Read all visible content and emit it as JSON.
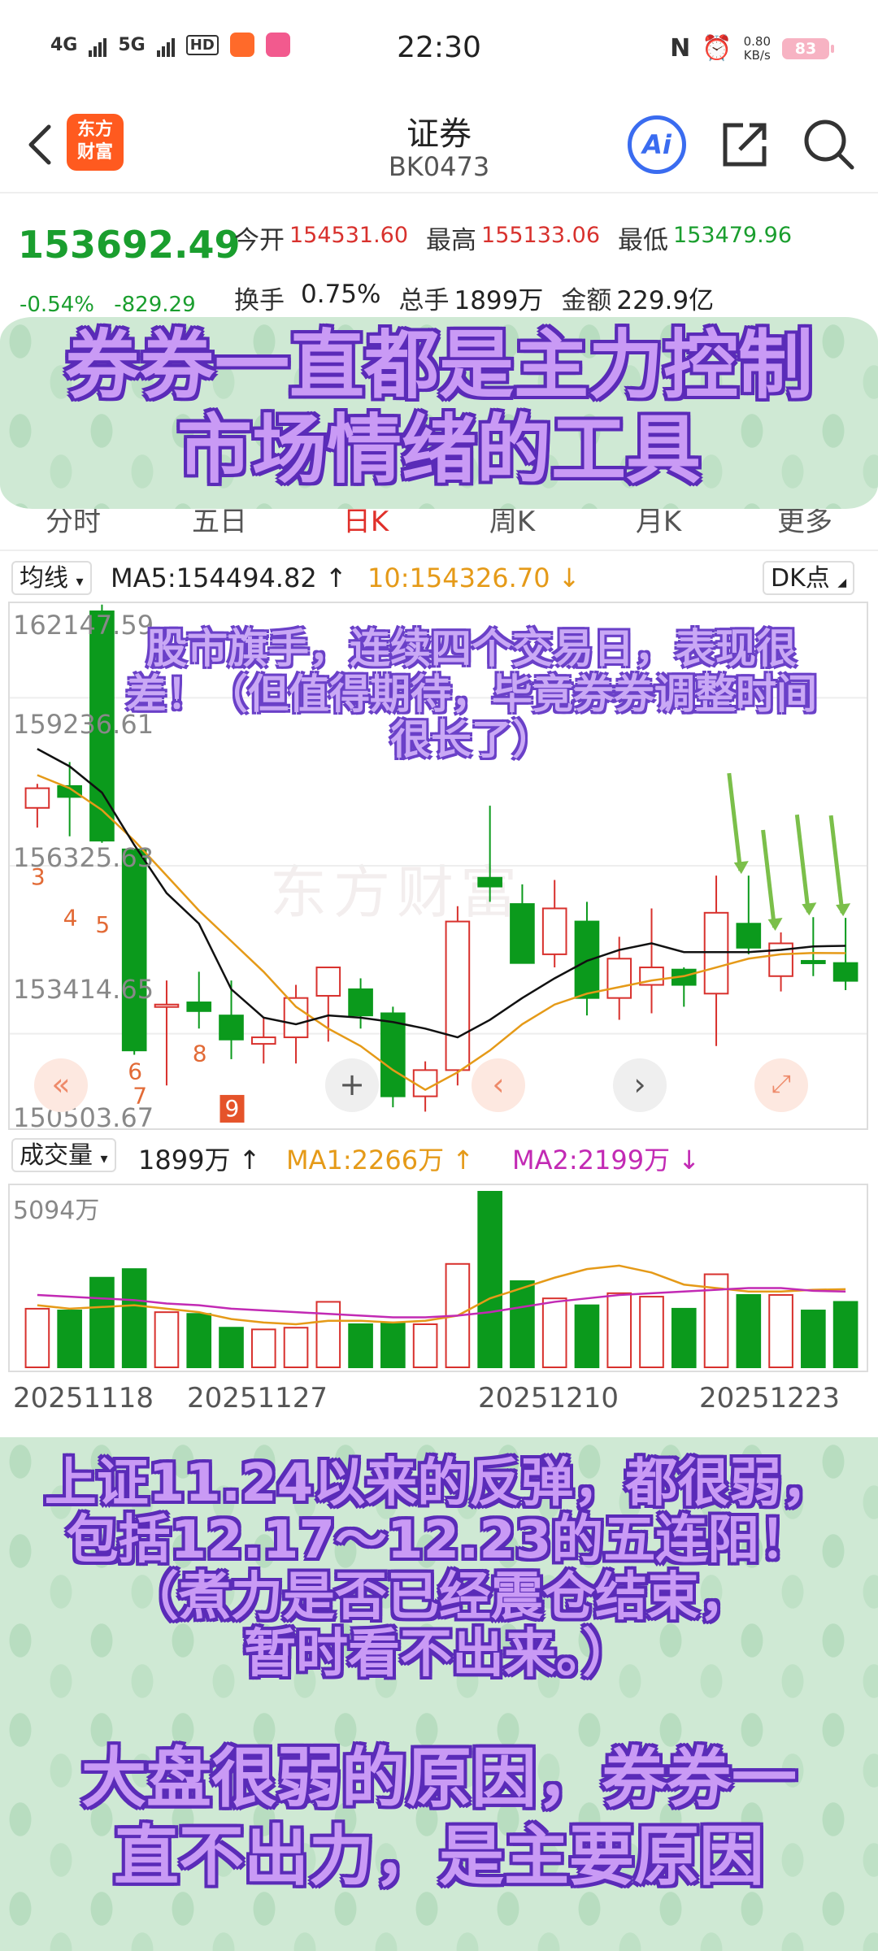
{
  "status_bar": {
    "network1": "4G",
    "network2": "5G",
    "hd_badge": "HD",
    "time": "22:30",
    "speed_value": "0.80",
    "speed_unit": "KB/s",
    "battery": "83"
  },
  "header": {
    "logo_line1": "东方",
    "logo_line2": "财富",
    "title": "证券",
    "code": "BK0473",
    "ai_label": "Ai"
  },
  "quote": {
    "price": "153692.49",
    "change_pct": "-0.54%",
    "change_abs": "-829.29",
    "open_label": "今开",
    "open_value": "154531.60",
    "high_label": "最高",
    "high_value": "155133.06",
    "low_label": "最低",
    "low_value": "153479.96",
    "turnover_label": "换手",
    "turnover_value": "0.75%",
    "volume_label": "总手",
    "volume_value": "1899万",
    "amount_label": "金额",
    "amount_value": "229.9亿"
  },
  "tabs": [
    "分时",
    "五日",
    "日K",
    "周K",
    "月K",
    "更多"
  ],
  "indicator": {
    "selector": "均线",
    "ma5": "MA5:154494.82 ↑",
    "ma10": "10:154326.70 ↓",
    "dk_button": "DK点"
  },
  "y_axis_labels": [
    "162147.59",
    "159236.61",
    "156325.63",
    "153414.65",
    "150503.67"
  ],
  "watermark": "东方财富",
  "volume_panel": {
    "selector": "成交量",
    "volume": "1899万 ↑",
    "ma1": "MA1:2266万 ↑",
    "ma2": "MA2:2199万 ↓",
    "max_label": "5094万"
  },
  "x_axis_labels": [
    "20251118",
    "20251127",
    "20251210",
    "20251223"
  ],
  "overlay_text": {
    "top": "券券一直都是主力控制市场情绪的工具",
    "chart_note": "股市旗手，连续四个交易日，表现很差！（但值得期待，毕竟券券调整时间很长了）",
    "bottom1_l1": "上证11.24以来的反弹，都很弱，",
    "bottom1_l2": "包括12.17～12.23的五连阳！",
    "bottom1_l3": "（煮力是否已经震仓结束，",
    "bottom1_l4": "暂时看不出来。）",
    "bottom2_l1": "大盘很弱的原因，券券一",
    "bottom2_l2": "直不出力，是主要原因"
  },
  "markers": [
    "3",
    "4",
    "5",
    "6",
    "7",
    "8",
    "9"
  ],
  "colors": {
    "up": "#d8312d",
    "down": "#0b9a1c",
    "ma5": "#111111",
    "ma10": "#e59a18",
    "vma2": "#c22ab4"
  },
  "chart_data": {
    "type": "candlestick",
    "ylim": [
      150503.67,
      162147.59
    ],
    "candles": [
      {
        "o": 157650,
        "h": 158200,
        "l": 157200,
        "c": 158100
      },
      {
        "o": 158150,
        "h": 158700,
        "l": 157000,
        "c": 157900
      },
      {
        "o": 162147,
        "h": 162300,
        "l": 156850,
        "c": 156900
      },
      {
        "o": 156700,
        "h": 156700,
        "l": 152000,
        "c": 152100
      },
      {
        "o": 153100,
        "h": 153700,
        "l": 151300,
        "c": 153150
      },
      {
        "o": 153200,
        "h": 153900,
        "l": 152600,
        "c": 153000
      },
      {
        "o": 152900,
        "h": 153700,
        "l": 151900,
        "c": 152350
      },
      {
        "o": 152250,
        "h": 152850,
        "l": 151800,
        "c": 152400
      },
      {
        "o": 152400,
        "h": 153600,
        "l": 151800,
        "c": 153300
      },
      {
        "o": 153350,
        "h": 153900,
        "l": 152300,
        "c": 154000
      },
      {
        "o": 153500,
        "h": 153750,
        "l": 152600,
        "c": 152900
      },
      {
        "o": 152950,
        "h": 153100,
        "l": 150800,
        "c": 151050
      },
      {
        "o": 151050,
        "h": 151850,
        "l": 150700,
        "c": 151650
      },
      {
        "o": 151650,
        "h": 155400,
        "l": 151300,
        "c": 155050
      },
      {
        "o": 156050,
        "h": 157700,
        "l": 155500,
        "c": 155850
      },
      {
        "o": 155450,
        "h": 155900,
        "l": 154200,
        "c": 154100
      },
      {
        "o": 154300,
        "h": 156000,
        "l": 154000,
        "c": 155350
      },
      {
        "o": 155050,
        "h": 155500,
        "l": 152900,
        "c": 153300
      },
      {
        "o": 153300,
        "h": 154700,
        "l": 152800,
        "c": 154200
      },
      {
        "o": 153600,
        "h": 155350,
        "l": 152950,
        "c": 154000
      },
      {
        "o": 153950,
        "h": 154000,
        "l": 153100,
        "c": 153600
      },
      {
        "o": 153400,
        "h": 156100,
        "l": 152200,
        "c": 155250
      },
      {
        "o": 155000,
        "h": 156100,
        "l": 154300,
        "c": 154450
      },
      {
        "o": 153800,
        "h": 154800,
        "l": 153450,
        "c": 154550
      },
      {
        "o": 154150,
        "h": 155150,
        "l": 153800,
        "c": 154100
      },
      {
        "o": 154100,
        "h": 155133,
        "l": 153480,
        "c": 153692
      }
    ],
    "ma5": [
      159000,
      158600,
      158000,
      156800,
      155700,
      155000,
      153500,
      152850,
      152700,
      152900,
      152850,
      152750,
      152600,
      152400,
      152800,
      153300,
      153750,
      154150,
      154400,
      154550,
      154350,
      154350,
      154350,
      154400,
      154480,
      154494
    ],
    "ma10": [
      158400,
      158100,
      157600,
      156900,
      156100,
      155300,
      154600,
      153900,
      153100,
      152600,
      152200,
      151650,
      151200,
      151600,
      152100,
      152700,
      153150,
      153400,
      153550,
      153700,
      153800,
      154000,
      154200,
      154300,
      154330,
      154326
    ],
    "volume": [
      1700,
      1650,
      2600,
      2850,
      1600,
      1550,
      1150,
      1100,
      1150,
      1900,
      1250,
      1300,
      1250,
      3000,
      5094,
      2500,
      2000,
      1800,
      2150,
      2050,
      1700,
      2700,
      2100,
      2100,
      1650,
      1899
    ],
    "vol_ma1": [
      1800,
      1700,
      1750,
      1800,
      1700,
      1600,
      1400,
      1300,
      1250,
      1350,
      1350,
      1300,
      1350,
      1500,
      2000,
      2300,
      2600,
      2850,
      2950,
      2750,
      2400,
      2300,
      2200,
      2200,
      2250,
      2266
    ],
    "vol_ma2": [
      2100,
      2050,
      2000,
      1950,
      1850,
      1800,
      1700,
      1650,
      1600,
      1550,
      1500,
      1450,
      1450,
      1500,
      1600,
      1750,
      1900,
      2000,
      2100,
      2150,
      2200,
      2250,
      2300,
      2300,
      2220,
      2199
    ],
    "vol_max": 5094
  }
}
